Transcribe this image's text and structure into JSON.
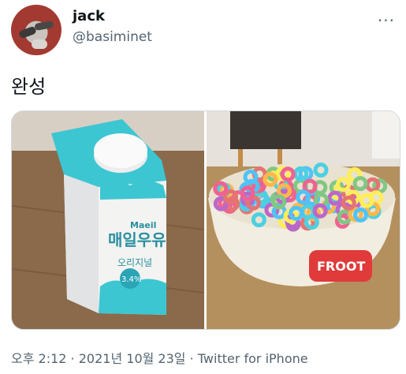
{
  "author": {
    "display_name": "jack",
    "handle": "@basiminet"
  },
  "tweet": {
    "text": "완성",
    "more_label": "···",
    "media": [
      {
        "name": "milk-carton-photo",
        "carton_brand": "Maeil",
        "carton_title": "매일우유",
        "carton_subtitle": "오리지널",
        "carton_badge": "3.4%"
      },
      {
        "name": "cereal-bowl-photo",
        "bowl_label": "FROOT"
      }
    ]
  },
  "meta": {
    "time": "오후 2:12",
    "separator": " · ",
    "date": "2021년 10월 23일",
    "source": "Twitter for iPhone"
  },
  "colors": {
    "handle_gray": "#536471",
    "carton_teal": "#3cc6d2"
  }
}
